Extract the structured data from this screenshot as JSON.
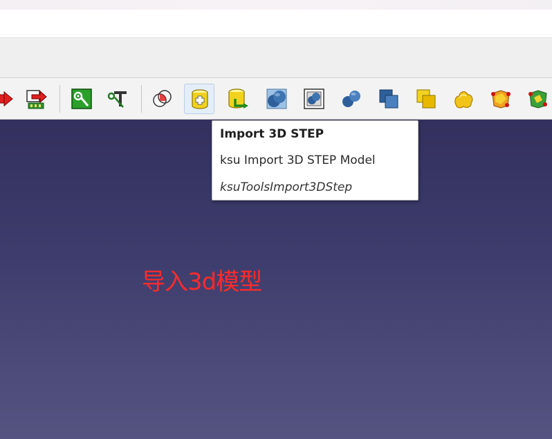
{
  "toolbar": {
    "buttons": [
      {
        "id": "placement-arrow-icon"
      },
      {
        "id": "pcb-push-icon"
      },
      {
        "id": "track-icon"
      },
      {
        "id": "text-tool-icon"
      },
      {
        "id": "shape-overlap-icon"
      },
      {
        "id": "import-3d-step-icon",
        "active": true
      },
      {
        "id": "export-3d-step-icon"
      },
      {
        "id": "fuse-pill-icon"
      },
      {
        "id": "boxed-pill-icon"
      },
      {
        "id": "pill-icon"
      },
      {
        "id": "blue-squares-icon"
      },
      {
        "id": "yellow-squares-icon"
      },
      {
        "id": "yellow-blob-icon"
      },
      {
        "id": "red-shape-icon"
      },
      {
        "id": "green-shape-icon"
      }
    ]
  },
  "tooltip": {
    "title": "Import 3D STEP",
    "description": "ksu Import 3D STEP Model",
    "command": "ksuToolsImport3DStep"
  },
  "annotation": {
    "text": "导入3d模型",
    "color": "#ff2a2a"
  },
  "colors": {
    "viewport_top": "#33305e",
    "viewport_bottom": "#555380",
    "toolbar_bg": "#f3f3f3"
  }
}
